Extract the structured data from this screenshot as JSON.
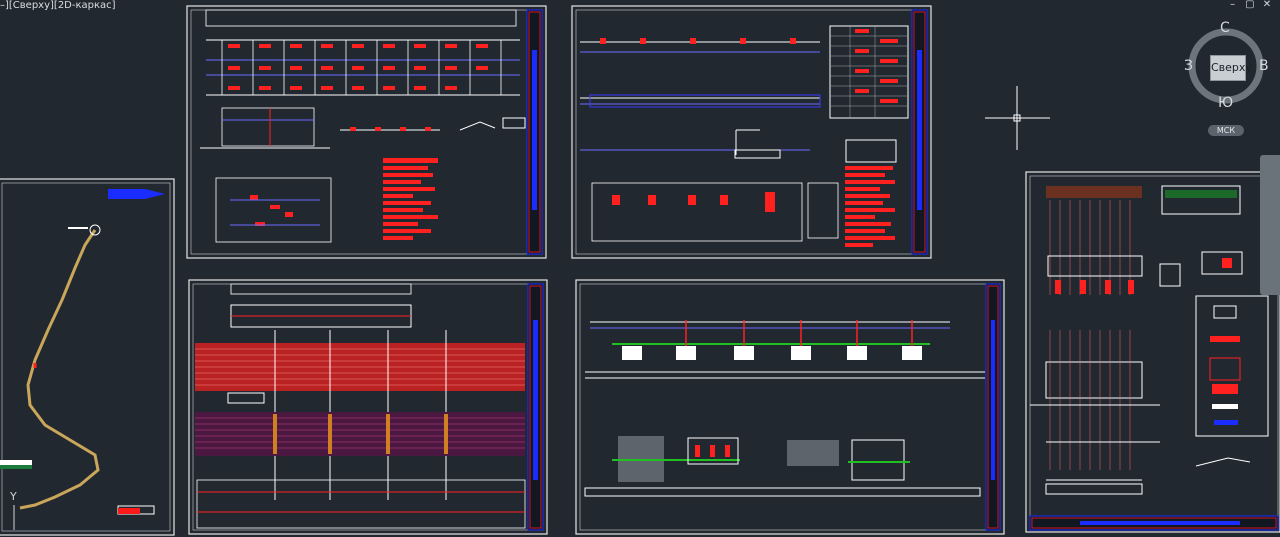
{
  "viewport": {
    "label": "–][Сверху][2D-каркас]"
  },
  "window_controls": {
    "minimize": "–",
    "restore": "▢",
    "close": "✕"
  },
  "viewcube": {
    "face": "Сверху",
    "north": "С",
    "south": "Ю",
    "west": "З",
    "east": "В"
  },
  "ucs": {
    "label": "МСК"
  },
  "axis": {
    "y": "Y"
  },
  "colors": {
    "background": "#212830",
    "sheet_border": "#e6e6e6",
    "title_block_blue": "#1a2cff",
    "title_block_red": "#ff1a1a",
    "dimension_red": "#ff2020",
    "line_blue": "#2b2bd9",
    "green": "#20c020",
    "route_yellow": "#c9a65a"
  },
  "icons": {
    "crosshair": "crosshair-icon",
    "viewcube": "viewcube-icon",
    "compass_ring": "compass-ring-icon"
  }
}
